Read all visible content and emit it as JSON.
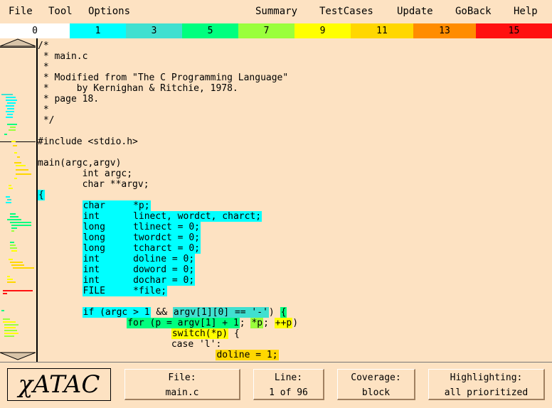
{
  "menu": {
    "left": [
      "File",
      "Tool",
      "Options"
    ],
    "right": [
      "Summary",
      "TestCases",
      "Update",
      "GoBack",
      "Help"
    ]
  },
  "colors": {
    "c0": "#ffffff",
    "c1": "#00ffff",
    "c3": "#40e0d0",
    "c5": "#00ff7f",
    "c7": "#9aff3c",
    "c9": "#ffff00",
    "c11": "#ffd700",
    "c13": "#ff8c00",
    "c15": "#ff1010",
    "background": "#fde2c2"
  },
  "colorbar": [
    {
      "label": "0",
      "color": "#ffffff"
    },
    {
      "label": "1",
      "color": "#00ffff"
    },
    {
      "label": "3",
      "color": "#40e0d0"
    },
    {
      "label": "5",
      "color": "#00ff7f"
    },
    {
      "label": "7",
      "color": "#9aff3c"
    },
    {
      "label": "9",
      "color": "#ffff00"
    },
    {
      "label": "11",
      "color": "#ffd700"
    },
    {
      "label": "13",
      "color": "#ff8c00"
    },
    {
      "label": "15",
      "color": "#ff1010"
    }
  ],
  "scrollbar": {
    "up_icon": "triangle-up-icon",
    "down_icon": "triangle-down-icon"
  },
  "code_lines": [
    [
      {
        "t": "/*"
      }
    ],
    [
      {
        "t": " * main.c"
      }
    ],
    [
      {
        "t": " *"
      }
    ],
    [
      {
        "t": " * Modified from \"The C Programming Language\""
      }
    ],
    [
      {
        "t": " *     by Kernighan & Ritchie, 1978."
      }
    ],
    [
      {
        "t": " * page 18."
      }
    ],
    [
      {
        "t": " *"
      }
    ],
    [
      {
        "t": " */"
      }
    ],
    [
      {
        "t": ""
      }
    ],
    [
      {
        "t": "#include <stdio.h>"
      }
    ],
    [
      {
        "t": ""
      }
    ],
    [
      {
        "t": "main(argc,argv)"
      }
    ],
    [
      {
        "t": "        int argc;"
      }
    ],
    [
      {
        "t": "        char **argv;"
      }
    ],
    [
      {
        "t": "{",
        "c": "c1"
      }
    ],
    [
      {
        "t": "        "
      },
      {
        "t": "char     *p;",
        "c": "c1"
      }
    ],
    [
      {
        "t": "        "
      },
      {
        "t": "int      linect, wordct, charct;",
        "c": "c1"
      }
    ],
    [
      {
        "t": "        "
      },
      {
        "t": "long     tlinect = 0;",
        "c": "c1"
      }
    ],
    [
      {
        "t": "        "
      },
      {
        "t": "long     twordct = 0;",
        "c": "c1"
      }
    ],
    [
      {
        "t": "        "
      },
      {
        "t": "long     tcharct = 0;",
        "c": "c1"
      }
    ],
    [
      {
        "t": "        "
      },
      {
        "t": "int      doline = 0;",
        "c": "c1"
      }
    ],
    [
      {
        "t": "        "
      },
      {
        "t": "int      doword = 0;",
        "c": "c1"
      }
    ],
    [
      {
        "t": "        "
      },
      {
        "t": "int      dochar = 0;",
        "c": "c1"
      }
    ],
    [
      {
        "t": "        "
      },
      {
        "t": "FILE     *file;",
        "c": "c1"
      }
    ],
    [
      {
        "t": ""
      }
    ],
    [
      {
        "t": "        "
      },
      {
        "t": "if (argc > 1",
        "c": "c1"
      },
      {
        "t": " && "
      },
      {
        "t": "argv[1][0] == '-'",
        "c": "c3"
      },
      {
        "t": ") "
      },
      {
        "t": "{",
        "c": "c5"
      }
    ],
    [
      {
        "t": "                "
      },
      {
        "t": "for (p = argv[1] + 1",
        "c": "c5"
      },
      {
        "t": "; "
      },
      {
        "t": "*p",
        "c": "c7"
      },
      {
        "t": "; "
      },
      {
        "t": "++p",
        "c": "c9"
      },
      {
        "t": ")"
      }
    ],
    [
      {
        "t": "                        "
      },
      {
        "t": "switch(*p)",
        "c": "c9"
      },
      {
        "t": " {"
      }
    ],
    [
      {
        "t": "                        case 'l':"
      }
    ],
    [
      {
        "t": "                                "
      },
      {
        "t": "doline = 1;",
        "c": "c11"
      }
    ]
  ],
  "status": {
    "logo": "χATAC",
    "file_label": "File:",
    "file_value": "main.c",
    "line_label": "Line:",
    "line_value": "1 of 96",
    "coverage_label": "Coverage:",
    "coverage_value": "block",
    "highlighting_label": "Highlighting:",
    "highlighting_value": "all prioritized"
  }
}
